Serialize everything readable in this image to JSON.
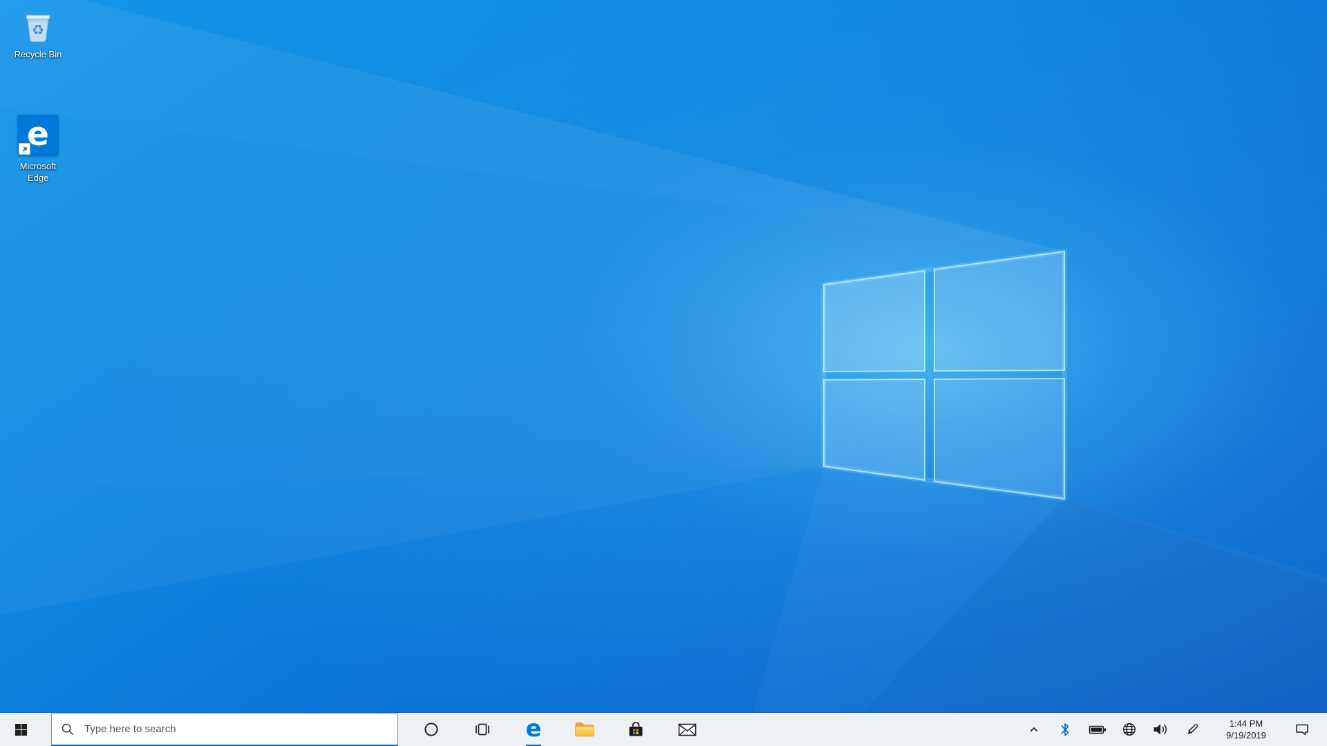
{
  "desktop": {
    "icons": [
      {
        "name": "recycle-bin",
        "label": "Recycle Bin"
      },
      {
        "name": "microsoft-edge-shortcut",
        "label": "Microsoft Edge",
        "glyph": "e"
      }
    ],
    "wallpaper": {
      "description": "windows-10-light-blue-logo",
      "base_color": "#0e84e0"
    }
  },
  "taskbar": {
    "background_color": "#eef1f4",
    "start": {
      "icon": "windows-logo"
    },
    "search": {
      "icon": "search-magnifier",
      "placeholder": "Type here to search"
    },
    "pinned": [
      {
        "icon": "cortana-circle"
      },
      {
        "icon": "task-view"
      },
      {
        "icon": "microsoft-edge",
        "glyph": "e",
        "running_indicator": true
      },
      {
        "icon": "file-explorer-folder"
      },
      {
        "icon": "microsoft-store-bag"
      },
      {
        "icon": "mail-envelope"
      }
    ],
    "tray": {
      "icons": [
        {
          "icon": "chevron-up-hidden-icons"
        },
        {
          "icon": "bluetooth"
        },
        {
          "icon": "battery"
        },
        {
          "icon": "network-globe"
        },
        {
          "icon": "volume-speaker"
        },
        {
          "icon": "windows-ink-pen"
        }
      ],
      "clock": {
        "time": "1:44 PM",
        "date": "9/19/2019"
      },
      "action_center": {
        "icon": "action-center-bubble"
      }
    }
  },
  "colors": {
    "accent": "#0078d7",
    "search_underline": "#0067c0",
    "bluetooth_blue": "#0072c9",
    "store_flag": [
      "#f25022",
      "#7fba00",
      "#00a4ef",
      "#ffb900"
    ],
    "folder_yellow": "#ffd35e"
  }
}
